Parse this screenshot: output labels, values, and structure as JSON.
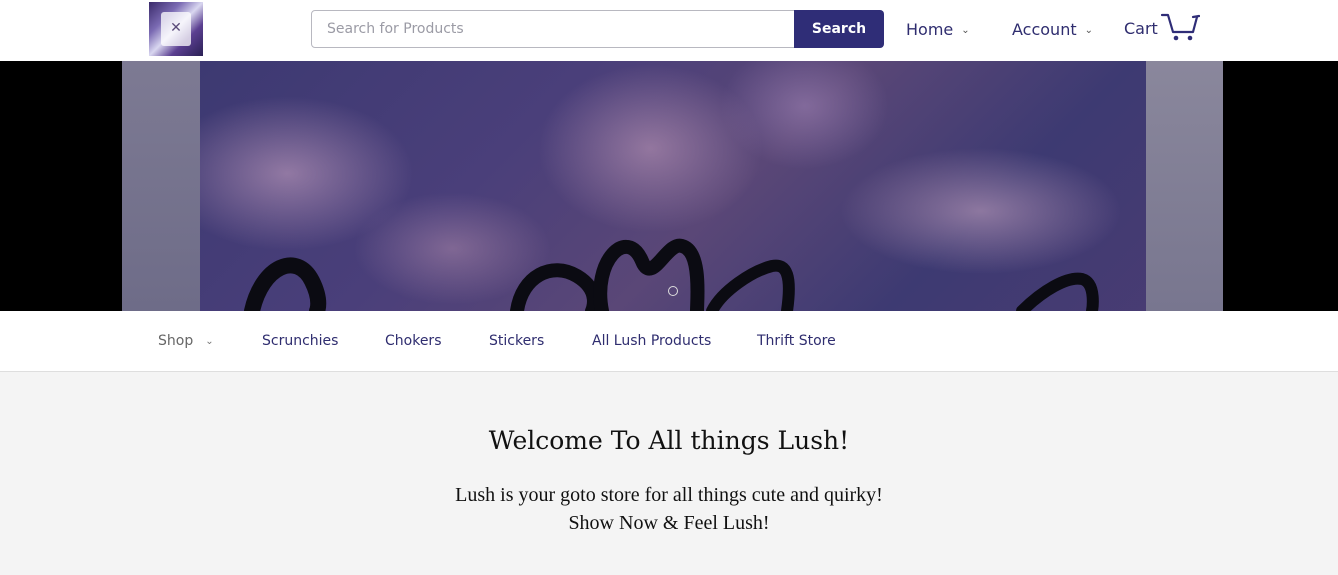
{
  "header": {
    "logo_alt": "Lush logo",
    "search": {
      "placeholder": "Search for Products",
      "value": "",
      "button_label": "Search"
    },
    "nav": {
      "home_label": "Home",
      "account_label": "Account",
      "cart_label": "Cart"
    }
  },
  "hero": {
    "slide_indicator": "current slide"
  },
  "categories": {
    "items": [
      {
        "label": "Shop"
      },
      {
        "label": "Scrunchies"
      },
      {
        "label": "Chokers"
      },
      {
        "label": "Stickers"
      },
      {
        "label": "All Lush Products"
      },
      {
        "label": "Thrift Store"
      }
    ]
  },
  "main": {
    "title": "Welcome To All things Lush!",
    "line1": "Lush is your goto store for all things cute and quirky!",
    "line2": "Show Now & Feel Lush!"
  },
  "colors": {
    "brand": "#2f2d77",
    "nav_text": "#2f2d6f",
    "background": "#f4f4f4"
  },
  "icons": [
    "chevron-down-icon",
    "cart-icon"
  ]
}
